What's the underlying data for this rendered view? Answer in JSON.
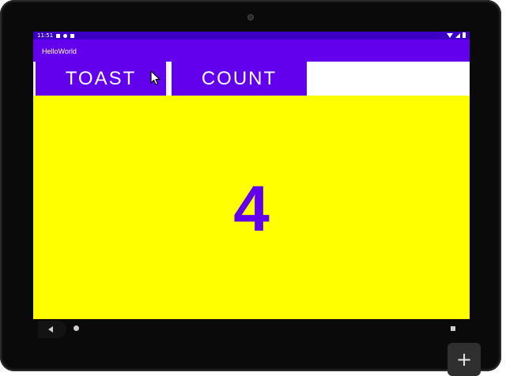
{
  "status_bar": {
    "time": "11:51"
  },
  "app_bar": {
    "title": "HelloWorld"
  },
  "buttons": {
    "toast_label": "TOAST",
    "count_label": "COUNT"
  },
  "counter": {
    "value": "4"
  },
  "fab": {
    "label": "+"
  },
  "icons": [
    "camera-icon",
    "wifi-icon",
    "signal-icon",
    "battery-icon",
    "mouse-cursor-icon",
    "back-icon",
    "home-icon",
    "recents-icon",
    "plus-icon"
  ],
  "colors": {
    "primary": "#6200ee",
    "primary_dark": "#3c00c4",
    "background": "#ffff00"
  }
}
